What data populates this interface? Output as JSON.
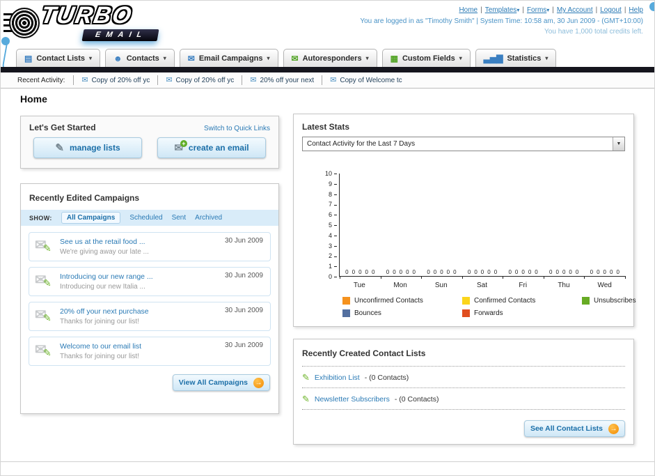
{
  "header": {
    "logo_main": "TURBO",
    "logo_sub": "EMAIL",
    "links": [
      {
        "label": "Home",
        "dropdown": false
      },
      {
        "label": "Templates",
        "dropdown": true
      },
      {
        "label": "Forms",
        "dropdown": true
      },
      {
        "label": "My Account",
        "dropdown": false
      },
      {
        "label": "Logout",
        "dropdown": false
      },
      {
        "label": "Help",
        "dropdown": false
      }
    ],
    "login_info": "You are logged in as \"Timothy Smith\" | System Time: 10:58 am, 30 Jun 2009 - (GMT+10:00)",
    "credits_info": "You have 1,000 total credits left."
  },
  "nav": {
    "tabs": [
      {
        "label": "Contact Lists",
        "icon": "contact-lists-icon",
        "glyph": "▤",
        "color": "#3a7fc1"
      },
      {
        "label": "Contacts",
        "icon": "contacts-icon",
        "glyph": "☻",
        "color": "#3a7fc1"
      },
      {
        "label": "Email Campaigns",
        "icon": "email-campaigns-icon",
        "glyph": "✉",
        "color": "#3a7fc1"
      },
      {
        "label": "Autoresponders",
        "icon": "autoresponders-icon",
        "glyph": "✉",
        "color": "#52a425"
      },
      {
        "label": "Custom Fields",
        "icon": "custom-fields-icon",
        "glyph": "▦",
        "color": "#52a425"
      },
      {
        "label": "Statistics",
        "icon": "statistics-icon",
        "glyph": "▃▅▇",
        "color": "#3a7fc1"
      }
    ]
  },
  "recent_activity": {
    "label": "Recent Activity:",
    "items": [
      "Copy of 20% off yc",
      "Copy of 20% off yc",
      "20% off your next",
      "Copy of Welcome tc"
    ]
  },
  "page_title": "Home",
  "get_started": {
    "title": "Let's Get Started",
    "switch_link": "Switch to Quick Links",
    "manage_lists": "manage lists",
    "create_email": "create an email"
  },
  "campaigns": {
    "title": "Recently Edited Campaigns",
    "show_label": "SHOW:",
    "filters": [
      "All Campaigns",
      "Scheduled",
      "Sent",
      "Archived"
    ],
    "selected_filter": "All Campaigns",
    "items": [
      {
        "title": "See us at the retail food ...",
        "subtitle": "We're giving away our late ...",
        "date": "30 Jun 2009"
      },
      {
        "title": "Introducing our new range ...",
        "subtitle": "Introducing our new Italia ...",
        "date": "30 Jun 2009"
      },
      {
        "title": "20% off your next purchase",
        "subtitle": "Thanks for joining our list!",
        "date": "30 Jun 2009"
      },
      {
        "title": "Welcome to our email list",
        "subtitle": "Thanks for joining our list!",
        "date": "30 Jun 2009"
      }
    ],
    "view_all": "View All Campaigns"
  },
  "stats": {
    "title": "Latest Stats",
    "period_selected": "Contact Activity for the Last 7 Days",
    "chart_data": {
      "type": "bar",
      "categories": [
        "Tue",
        "Mon",
        "Sun",
        "Sat",
        "Fri",
        "Thu",
        "Wed"
      ],
      "series": [
        {
          "name": "Unconfirmed Contacts",
          "color": "#f5921e",
          "values": [
            0,
            0,
            0,
            0,
            0,
            0,
            0
          ]
        },
        {
          "name": "Confirmed Contacts",
          "color": "#fbd51c",
          "values": [
            0,
            0,
            0,
            0,
            0,
            0,
            0
          ]
        },
        {
          "name": "Unsubscribes",
          "color": "#67ab24",
          "values": [
            0,
            0,
            0,
            0,
            0,
            0,
            0
          ]
        },
        {
          "name": "Bounces",
          "color": "#5470a0",
          "values": [
            0,
            0,
            0,
            0,
            0,
            0,
            0
          ]
        },
        {
          "name": "Forwards",
          "color": "#e04e1f",
          "values": [
            0,
            0,
            0,
            0,
            0,
            0,
            0
          ]
        }
      ],
      "ylim": [
        0,
        10
      ],
      "ytick_step": 1,
      "grid": false,
      "legend_position": "bottom"
    }
  },
  "contact_lists": {
    "title": "Recently Created Contact Lists",
    "items": [
      {
        "name": "Exhibition List",
        "count": "- (0 Contacts)"
      },
      {
        "name": "Newsletter Subscribers",
        "count": "- (0 Contacts)"
      }
    ],
    "see_all": "See All Contact Lists"
  }
}
